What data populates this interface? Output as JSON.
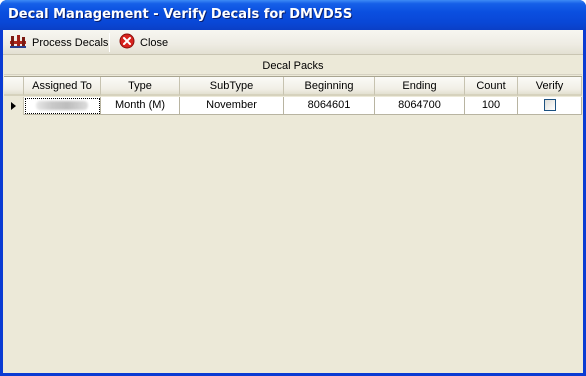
{
  "window": {
    "title": "Decal Management - Verify Decals for DMVD5S"
  },
  "toolbar": {
    "process_label": "Process Decals",
    "process_icon": "process-decals-icon",
    "close_label": "Close",
    "close_icon": "close-icon"
  },
  "grid": {
    "caption": "Decal Packs",
    "columns": [
      "Assigned To",
      "Type",
      "SubType",
      "Beginning",
      "Ending",
      "Count",
      "Verify"
    ],
    "rows": [
      {
        "assigned_to": "",
        "type": "Month (M)",
        "subtype": "November",
        "beginning": "8064601",
        "ending": "8064700",
        "count": "100",
        "verify": false
      }
    ]
  },
  "colors": {
    "titlebar": "#0a4fe0",
    "client_bg": "#ece9d8",
    "close_icon_red": "#d8231e"
  }
}
